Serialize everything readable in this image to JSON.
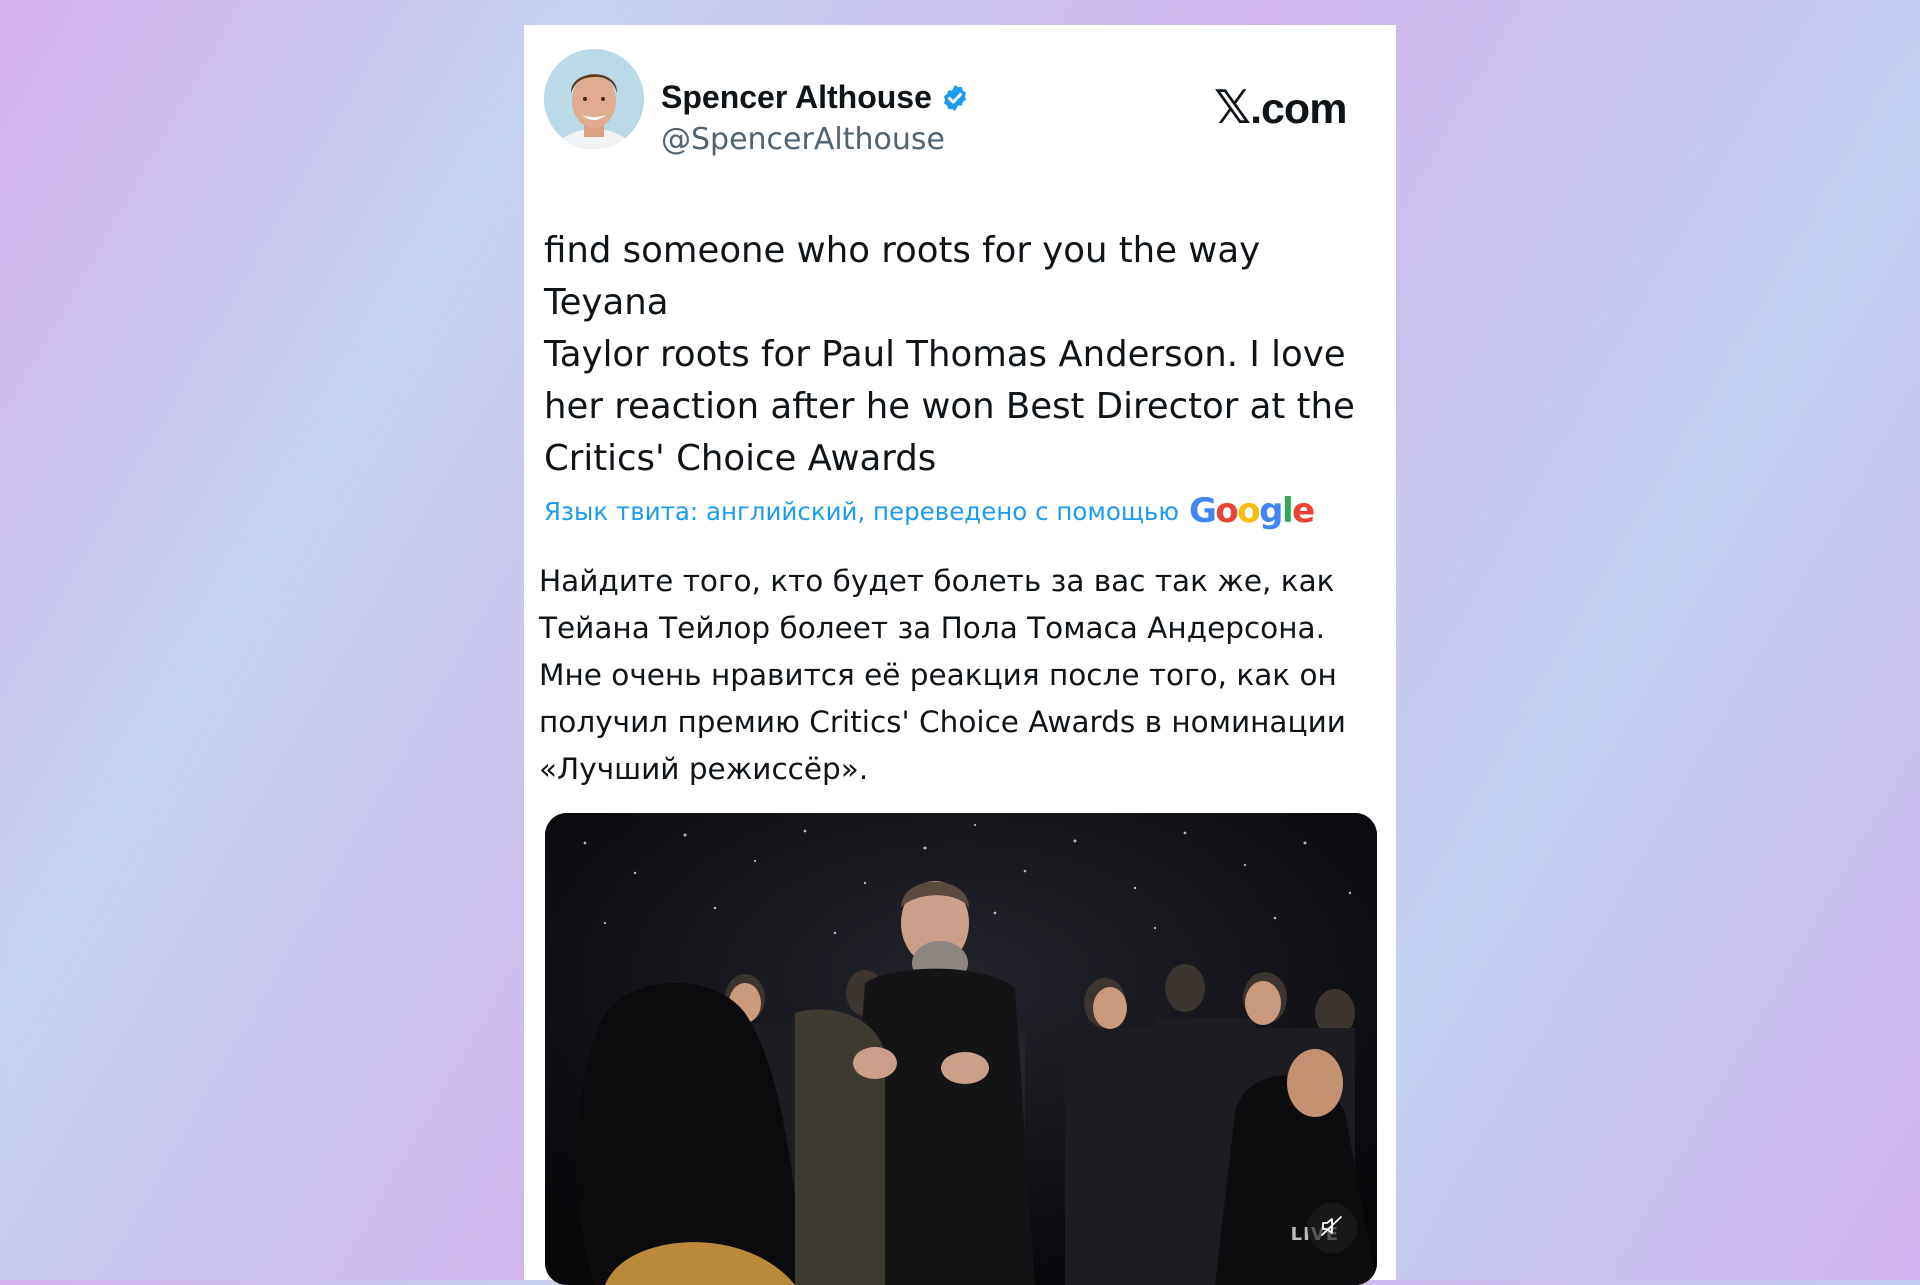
{
  "tweet": {
    "author": {
      "display_name": "Spencer Althouse",
      "handle": "@SpencerAlthouse",
      "verified": true
    },
    "site_logo": {
      "mark": "𝕏",
      "text": ".com"
    },
    "text_lines": [
      "find someone who roots for you the way Teyana",
      "Taylor roots for Paul Thomas Anderson. I love",
      "her reaction after he won Best Director at the",
      "Critics' Choice Awards"
    ],
    "translation": {
      "label": "Язык твита: английский, переведено с помощью",
      "provider_letters": [
        "G",
        "o",
        "o",
        "g",
        "l",
        "e"
      ],
      "text_lines": [
        "Найдите того, кто будет болеть за вас так же, как",
        "Тейана Тейлор болеет за Пола Томаса Андерсона.",
        "Мне очень нравится её реакция после того, как он",
        "получил премию Critics' Choice Awards в номинации",
        "«Лучший режиссёр»."
      ]
    },
    "media": {
      "type": "video",
      "badge": "LIVE",
      "muted": true,
      "icons": [
        "speaker-muted-icon"
      ]
    }
  },
  "colors": {
    "link_blue": "#1d9bf0",
    "verified_blue": "#1d9bf0",
    "text_primary": "#0f1419",
    "text_secondary": "#536471",
    "google_blue": "#4285f4",
    "google_red": "#ea4335",
    "google_yellow": "#fbbc05",
    "google_green": "#34a853"
  }
}
